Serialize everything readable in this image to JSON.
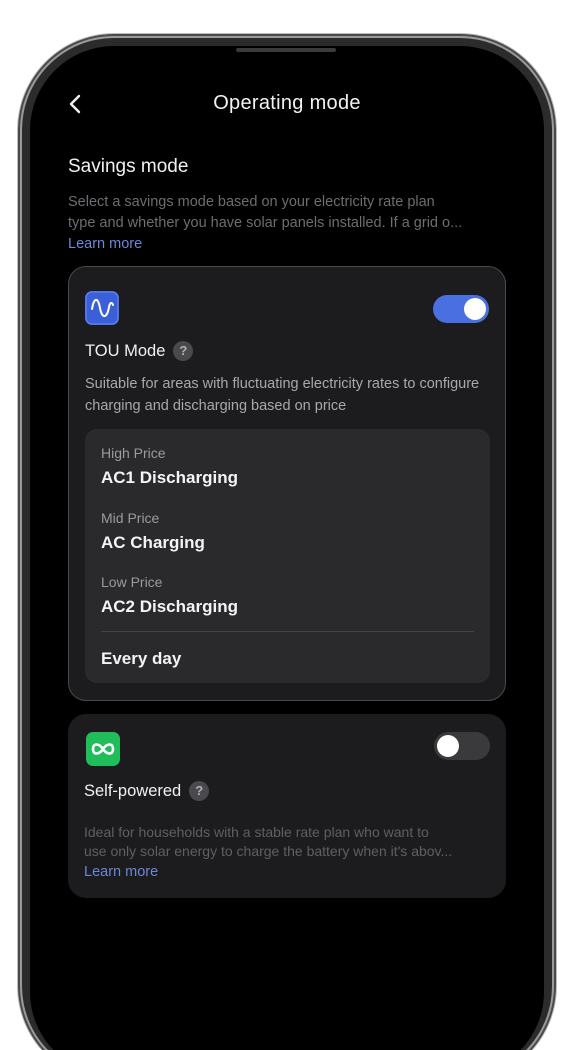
{
  "header": {
    "title": "Operating mode",
    "back_icon": "chevron-left-icon"
  },
  "savings": {
    "title": "Savings mode",
    "description_line1": "Select a savings mode based on your electricity rate plan",
    "description_line2": "type and whether you have solar panels installed. If a grid o...",
    "learn_more": "Learn more"
  },
  "tou": {
    "icon": "sine-wave-icon",
    "title": "TOU Mode",
    "help": "?",
    "enabled": true,
    "description": "Suitable for areas with fluctuating electricity rates to configure charging and discharging based on price",
    "prices": [
      {
        "label": "High Price",
        "value": "AC1 Discharging"
      },
      {
        "label": "Mid Price",
        "value": "AC Charging"
      },
      {
        "label": "Low Price",
        "value": "AC2 Discharging"
      }
    ],
    "schedule": "Every day"
  },
  "self_powered": {
    "icon": "infinity-icon",
    "title": "Self-powered",
    "help": "?",
    "enabled": false,
    "description_line1": "Ideal for households with a stable rate plan who want to",
    "description_line2": "use only solar energy to charge the battery when it's abov...",
    "learn_more": "Learn more"
  },
  "colors": {
    "accent_blue": "#4a6fe0",
    "tou_icon_bg": "#3b5fd8",
    "self_icon_bg": "#1fbe5a",
    "toggle_off": "#3a3a3c"
  }
}
